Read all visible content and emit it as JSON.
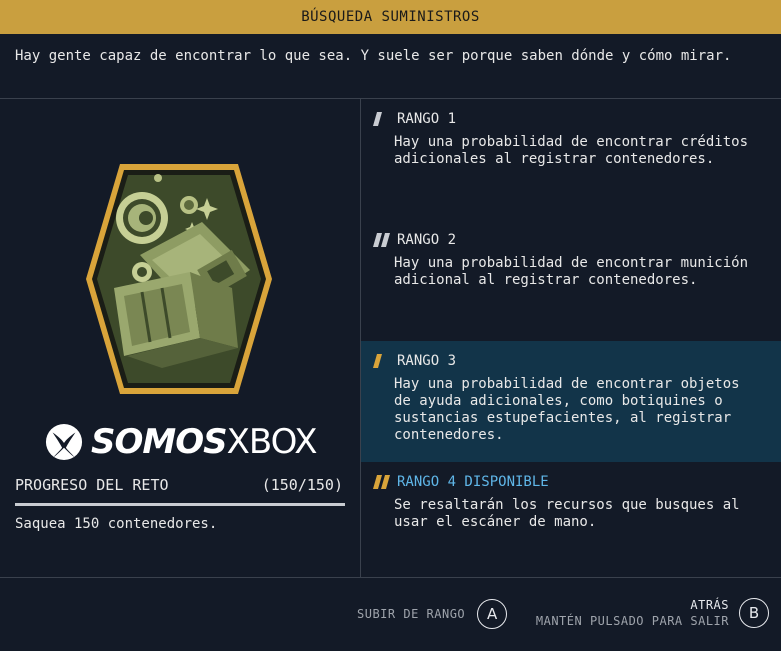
{
  "header": {
    "title": "BÚSQUEDA SUMINISTROS"
  },
  "intro": "Hay gente capaz de encontrar lo que sea. Y suele ser porque saben dónde y cómo mirar.",
  "skill": {
    "badge_icon": "crate-scanner-badge",
    "badge_colors": {
      "frame": "#d9a43a",
      "fill": "#3d4a2a",
      "art": "#a7b47a"
    }
  },
  "watermark": {
    "part1": "SOMOS",
    "part2": "XBOX"
  },
  "challenge": {
    "label": "PROGRESO DEL RETO",
    "count": "(150/150)",
    "progress": 1.0,
    "description": "Saquea 150 contenedores."
  },
  "ranks": [
    {
      "title": "RANGO 1",
      "text": "Hay una probabilidad de encontrar créditos adicionales al registrar contenedores.",
      "state": "unlocked"
    },
    {
      "title": "RANGO 2",
      "text": "Hay una probabilidad de encontrar munición adicional al registrar contenedores.",
      "state": "unlocked"
    },
    {
      "title": "RANGO 3",
      "text": "Hay una probabilidad de encontrar objetos de ayuda adicionales, como botiquines o sustancias estupefacientes, al registrar contenedores.",
      "state": "selected"
    },
    {
      "title": "RANGO 4 DISPONIBLE",
      "text": "Se resaltarán los recursos que busques al usar el escáner de mano.",
      "state": "available"
    }
  ],
  "footer": {
    "rank_up_label": "SUBIR DE RANGO",
    "rank_up_button": "A",
    "back_title": "ATRÁS",
    "back_subtitle": "MANTÉN PULSADO PARA SALIR",
    "back_button": "B"
  },
  "colors": {
    "accent_gold": "#c99f3f",
    "highlight": "#123449",
    "available_blue": "#5fb6e8",
    "background": "#131a27"
  }
}
